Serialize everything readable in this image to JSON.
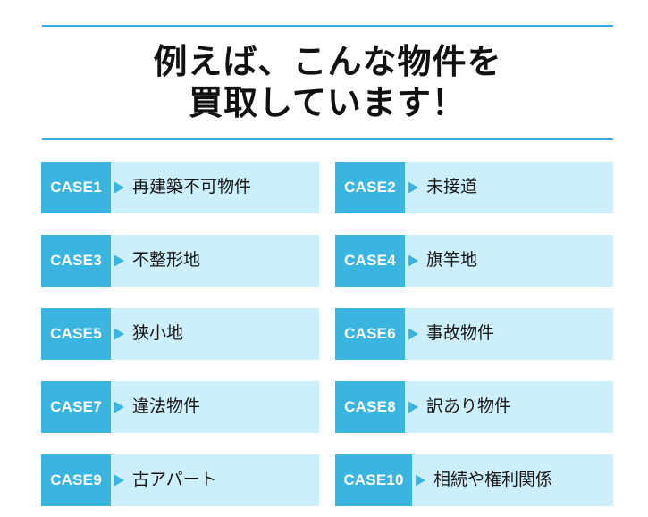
{
  "colors": {
    "accent": "#39b5e0",
    "rule": "#35aadd",
    "card_body": "#cdeffc",
    "heading_text": "#111111",
    "case_title_text": "#161616",
    "badge_text": "#ffffff",
    "background": "#ffffff"
  },
  "heading": {
    "line1": "例えば、こんな物件を",
    "line2": "買取しています！"
  },
  "cases": [
    {
      "badge": "CASE1",
      "title": "再建築不可物件"
    },
    {
      "badge": "CASE2",
      "title": "未接道"
    },
    {
      "badge": "CASE3",
      "title": "不整形地"
    },
    {
      "badge": "CASE4",
      "title": "旗竿地"
    },
    {
      "badge": "CASE5",
      "title": "狭小地"
    },
    {
      "badge": "CASE6",
      "title": "事故物件"
    },
    {
      "badge": "CASE7",
      "title": "違法物件"
    },
    {
      "badge": "CASE8",
      "title": "訳あり物件"
    },
    {
      "badge": "CASE9",
      "title": "古アパート"
    },
    {
      "badge": "CASE10",
      "title": "相続や権利関係"
    }
  ]
}
